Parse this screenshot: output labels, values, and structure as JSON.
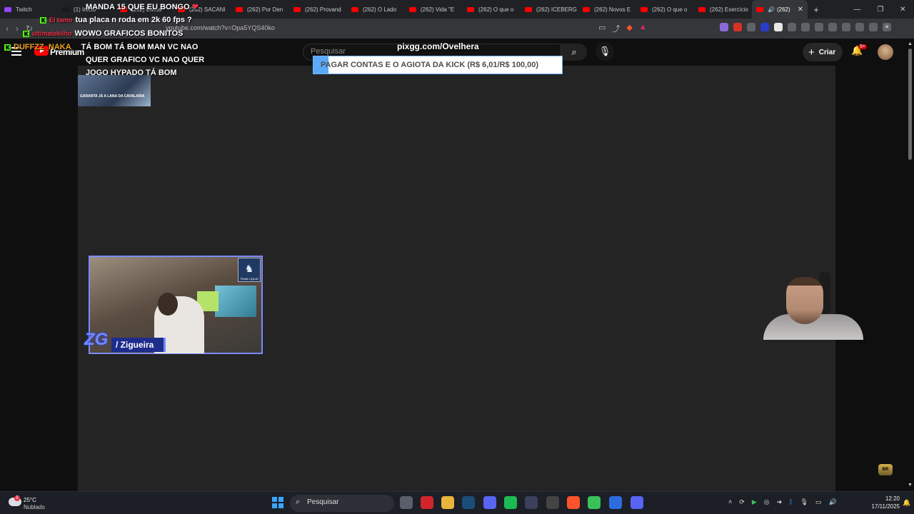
{
  "browser": {
    "tabs": [
      {
        "label": "Twitch",
        "color": "#9146ff"
      },
      {
        "label": "(1) Início",
        "color": "#1a1a1a"
      },
      {
        "label": "(262) Livros",
        "color": "#ff0000"
      },
      {
        "label": "(262) SACANI",
        "color": "#ff0000"
      },
      {
        "label": "(262) Por Den",
        "color": "#ff0000"
      },
      {
        "label": "(262) Provand",
        "color": "#ff0000"
      },
      {
        "label": "(262) O Lado",
        "color": "#ff0000"
      },
      {
        "label": "(262) Vida \"E",
        "color": "#ff0000"
      },
      {
        "label": "(262) O que o",
        "color": "#ff0000"
      },
      {
        "label": "(262) ICEBERG",
        "color": "#ff0000"
      },
      {
        "label": "(262) Novos E",
        "color": "#ff0000"
      },
      {
        "label": "(262) O que o",
        "color": "#ff0000"
      },
      {
        "label": "(262) Exercício",
        "color": "#ff0000"
      }
    ],
    "active_tab": {
      "label": "(262)",
      "close": "✕"
    },
    "new_tab": "+",
    "url": "youtube.com/watch?v=Opa5YQS40ko"
  },
  "youtube": {
    "premium": "Premium",
    "search_placeholder": "Pesquisar",
    "create": "Criar",
    "notif_badge": "9+"
  },
  "overlay": {
    "pix": "pixgg.com/Ovelhera",
    "goal_text": "PAGAR CONTAS E O AGIOTA DA KICK (R$ 6,01/R$ 100,00)",
    "goal_progress": 0.06,
    "chat": [
      {
        "user": "",
        "text": "MANDA 15 QUE EU BONGO"
      },
      {
        "user": "El tamo",
        "text": "tua placa n roda em 2k 60 fps ?"
      },
      {
        "user": "ultimatekilho",
        "text": "WOWO GRAFICOS BONITOS"
      },
      {
        "user": "DUFFZZ_NAKA",
        "text": "TÁ BOM TÁ BOM MAN VC NAO"
      },
      {
        "user": "",
        "text": "QUER GRAFICO VC NAO QUER"
      },
      {
        "user": "",
        "text": "JOGO HYPADO TÁ BOM"
      }
    ],
    "chat_thumb_text": "GARANTA JÁ A LANA DA CAVALARIA",
    "team_logo_text": "TEAM LIQUID",
    "cam_badge": "ZG",
    "cam_name": "/ Zigueira"
  },
  "taskbar": {
    "temp": "25°C",
    "condition": "Nublado",
    "search": "Pesquisar",
    "time": "12:20",
    "date": "17/11/2025",
    "apps": [
      {
        "name": "file-explorer-taskview",
        "color": "#5a5f6b"
      },
      {
        "name": "opera",
        "color": "#d2242c"
      },
      {
        "name": "folders",
        "color": "#e8b43a"
      },
      {
        "name": "steam",
        "color": "#1b4d7a"
      },
      {
        "name": "discord-alt",
        "color": "#5865f2"
      },
      {
        "name": "spotify",
        "color": "#1db954"
      },
      {
        "name": "arrow-app",
        "color": "#3b3f5c"
      },
      {
        "name": "settings-app",
        "color": "#444"
      },
      {
        "name": "brave",
        "color": "#fb542b"
      },
      {
        "name": "play-app",
        "color": "#3ac15a"
      },
      {
        "name": "download-app",
        "color": "#2d6cdf"
      },
      {
        "name": "discord",
        "color": "#5865f2"
      }
    ]
  }
}
